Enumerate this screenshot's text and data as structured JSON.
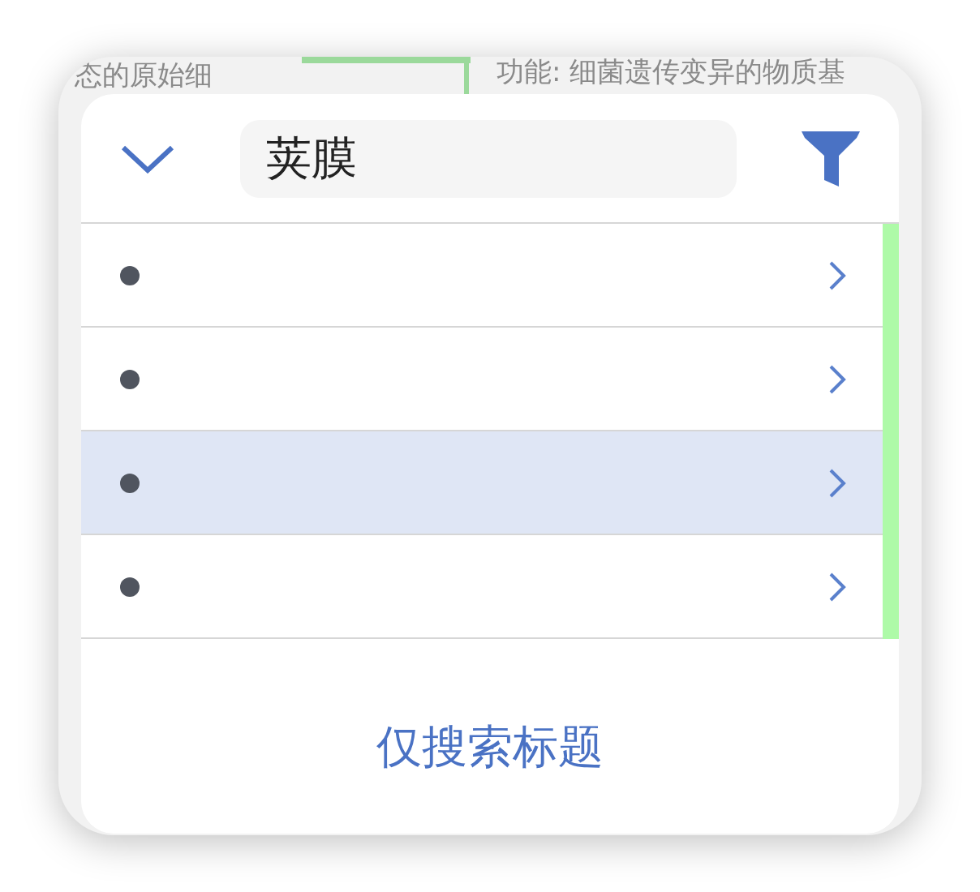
{
  "background": {
    "texts": [
      {
        "text": "态的原始细"
      },
      {
        "text": "功能: 细菌遗传变异的物质基"
      }
    ]
  },
  "search": {
    "value": "荚膜"
  },
  "results": [
    {
      "selected": false
    },
    {
      "selected": false
    },
    {
      "selected": true
    },
    {
      "selected": false
    }
  ],
  "footer": {
    "label": "仅搜索标题"
  }
}
